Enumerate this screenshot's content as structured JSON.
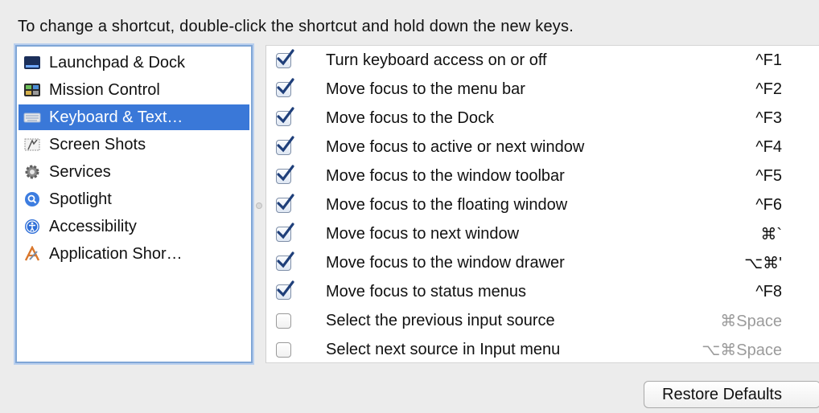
{
  "instruction": "To change a shortcut, double-click the shortcut and hold down the new keys.",
  "categories": [
    {
      "label": "Launchpad & Dock",
      "icon": "launchpad-dock-icon",
      "selected": false
    },
    {
      "label": "Mission Control",
      "icon": "mission-control-icon",
      "selected": false
    },
    {
      "label": "Keyboard & Text…",
      "icon": "keyboard-icon",
      "selected": true
    },
    {
      "label": "Screen Shots",
      "icon": "screenshot-icon",
      "selected": false
    },
    {
      "label": "Services",
      "icon": "gear-icon",
      "selected": false
    },
    {
      "label": "Spotlight",
      "icon": "spotlight-search-icon",
      "selected": false
    },
    {
      "label": "Accessibility",
      "icon": "accessibility-icon",
      "selected": false
    },
    {
      "label": "Application Shor…",
      "icon": "app-store-icon",
      "selected": false
    }
  ],
  "shortcuts": [
    {
      "checked": true,
      "label": "Turn keyboard access on or off",
      "key": "^F1"
    },
    {
      "checked": true,
      "label": "Move focus to the menu bar",
      "key": "^F2"
    },
    {
      "checked": true,
      "label": "Move focus to the Dock",
      "key": "^F3"
    },
    {
      "checked": true,
      "label": "Move focus to active or next window",
      "key": "^F4"
    },
    {
      "checked": true,
      "label": "Move focus to the window toolbar",
      "key": "^F5"
    },
    {
      "checked": true,
      "label": "Move focus to the floating window",
      "key": "^F6"
    },
    {
      "checked": true,
      "label": "Move focus to next window",
      "key": "⌘`"
    },
    {
      "checked": true,
      "label": "Move focus to the window drawer",
      "key": "⌥⌘'"
    },
    {
      "checked": true,
      "label": "Move focus to status menus",
      "key": "^F8"
    },
    {
      "checked": false,
      "label": "Select the previous input source",
      "key": "⌘Space"
    },
    {
      "checked": false,
      "label": "Select next source in Input menu",
      "key": "⌥⌘Space"
    }
  ],
  "restore_button": "Restore Defaults",
  "colors": {
    "selection": "#3a78d8",
    "checkmark": "#1f3f7a"
  }
}
